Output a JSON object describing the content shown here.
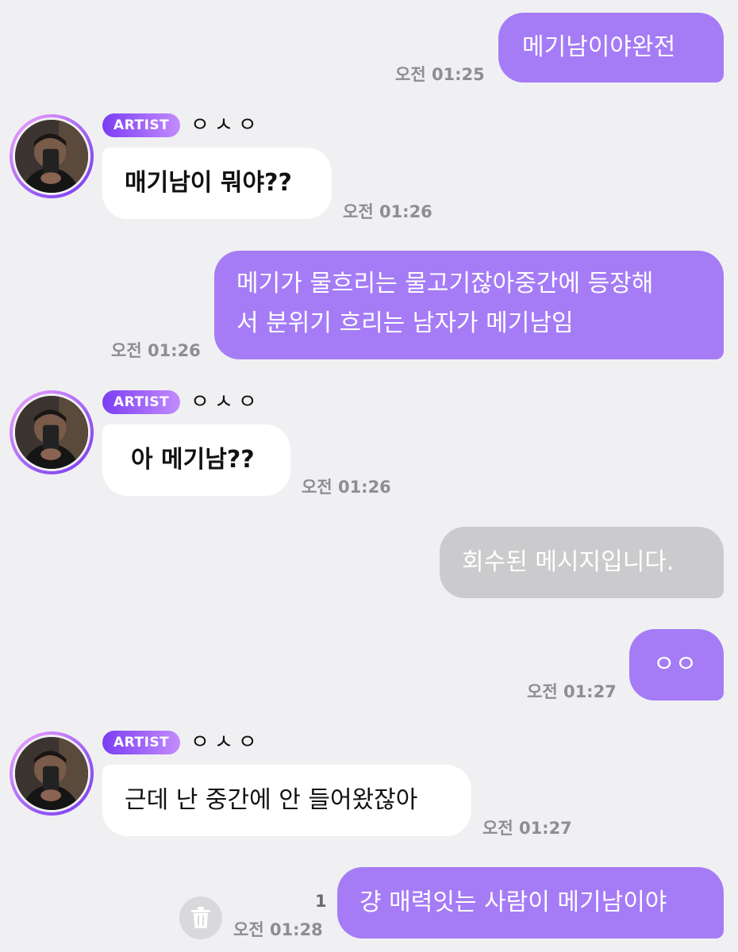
{
  "artist_badge_label": "ARTIST",
  "artist_name": "ㅇㅅㅇ",
  "messages": [
    {
      "text": "메기남이야완전",
      "time": "오전 01:25"
    },
    {
      "text": "매기남이 뭐야??",
      "time": "오전 01:26"
    },
    {
      "line1": "메기가 물흐리는 물고기잖아중간에 등장해",
      "line2": "서 분위기 흐리는 남자가 메기남임",
      "time": "오전 01:26"
    },
    {
      "text": "아 메기남??",
      "time": "오전 01:26"
    },
    {
      "text": "회수된 메시지입니다."
    },
    {
      "text": "ㅇㅇ",
      "time": "오전 01:27"
    },
    {
      "text": "근데 난 중간에 안 들어왔잖아",
      "time": "오전 01:27"
    },
    {
      "text": "걍 매력잇는 사람이 메기남이야",
      "time": "오전 01:28",
      "unread": "1"
    }
  ],
  "colors": {
    "outgoing_bubble": "#a57cf6",
    "incoming_bubble": "#ffffff",
    "recalled_bubble": "#cbcbcd",
    "background": "#f0f0f2"
  },
  "icons": {
    "delete": "trash-icon",
    "avatar": "artist-avatar"
  }
}
